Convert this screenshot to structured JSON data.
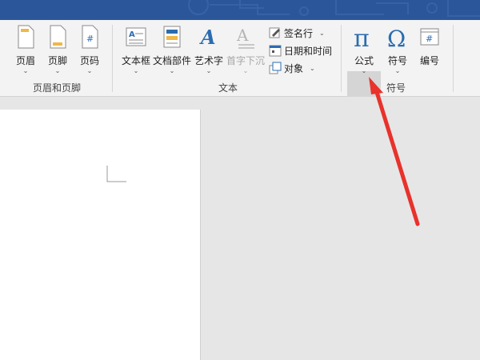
{
  "ribbon": {
    "groups": {
      "header_footer": "页眉和页脚",
      "text": "文本",
      "symbols": "符号"
    },
    "buttons": {
      "header": "页眉",
      "footer": "页脚",
      "page_number": "页码",
      "text_box": "文本框",
      "quick_parts": "文档部件",
      "wordart": "艺术字",
      "drop_cap": "首字下沉",
      "signature_line": "签名行",
      "date_time": "日期和时间",
      "object": "对象",
      "equation": "公式",
      "symbol": "符号",
      "number": "编号"
    },
    "chevron": "⌄"
  },
  "colors": {
    "titlebar": "#2b579a",
    "icon_blue": "#2b6cb0",
    "arrow": "#e8322b"
  },
  "icons": {
    "equation": "pi-icon",
    "symbol": "omega-icon",
    "number": "hash-icon"
  }
}
